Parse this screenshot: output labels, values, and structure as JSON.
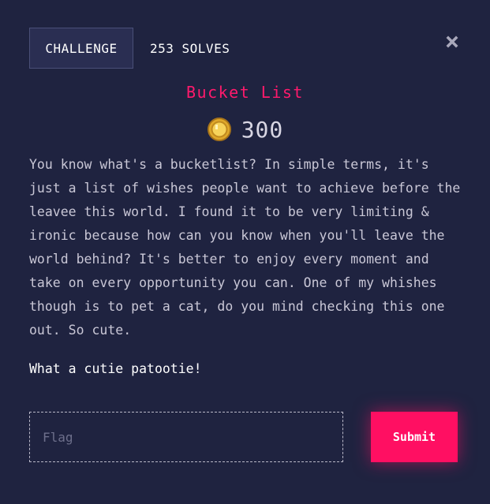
{
  "tabs": {
    "challenge_label": "CHALLENGE",
    "solves_label": "253 SOLVES"
  },
  "challenge": {
    "title": "Bucket List",
    "points": "300",
    "description": "You know what's a bucketlist? In simple terms, it's just a list of wishes people want to achieve before the leavee this world. I found it to be very limiting & ironic because how can you know when you'll leave the world behind? It's better to enjoy every moment and take on every opportunity you can. One of my whishes though is to pet a cat, do you mind checking this one out. So cute.",
    "tagline": "What a cutie patootie!"
  },
  "form": {
    "flag_placeholder": "Flag",
    "flag_value": "",
    "submit_label": "Submit"
  },
  "icons": {
    "close": "close-icon",
    "coin": "coin-icon"
  },
  "colors": {
    "background": "#1f2340",
    "accent": "#ff0f62",
    "title": "#ff1a6c",
    "coin": "#f5c542"
  }
}
